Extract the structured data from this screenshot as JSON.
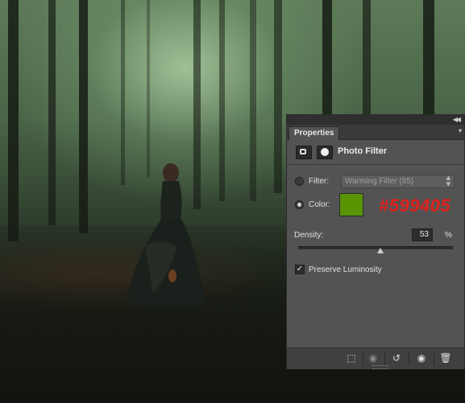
{
  "panel": {
    "tab_label": "Properties",
    "title": "Photo Filter",
    "filter_label": "Filter:",
    "filter_value": "Warming Filter (85)",
    "color_label": "Color:",
    "color_hex": "#599405",
    "color_annotation": "#599405",
    "density_label": "Density:",
    "density_value": "53",
    "density_unit": "%",
    "density_level_percent": 53,
    "preserve_luminosity_label": "Preserve Luminosity",
    "preserve_luminosity_checked": true,
    "selected_mode": "color",
    "icons": {
      "collapse": "double-chevron-right-icon",
      "menu": "panel-menu-icon",
      "adjustment": "photo-filter-adjustment-icon",
      "mask": "layer-mask-icon",
      "clip": "clip-to-layer-icon",
      "view_previous": "view-previous-state-icon",
      "reset": "reset-icon",
      "visibility": "eye-icon",
      "delete": "trash-icon"
    }
  },
  "colors": {
    "annotation_red": "#e2211b",
    "panel_bg": "#535353",
    "filter_color": "#599405"
  }
}
